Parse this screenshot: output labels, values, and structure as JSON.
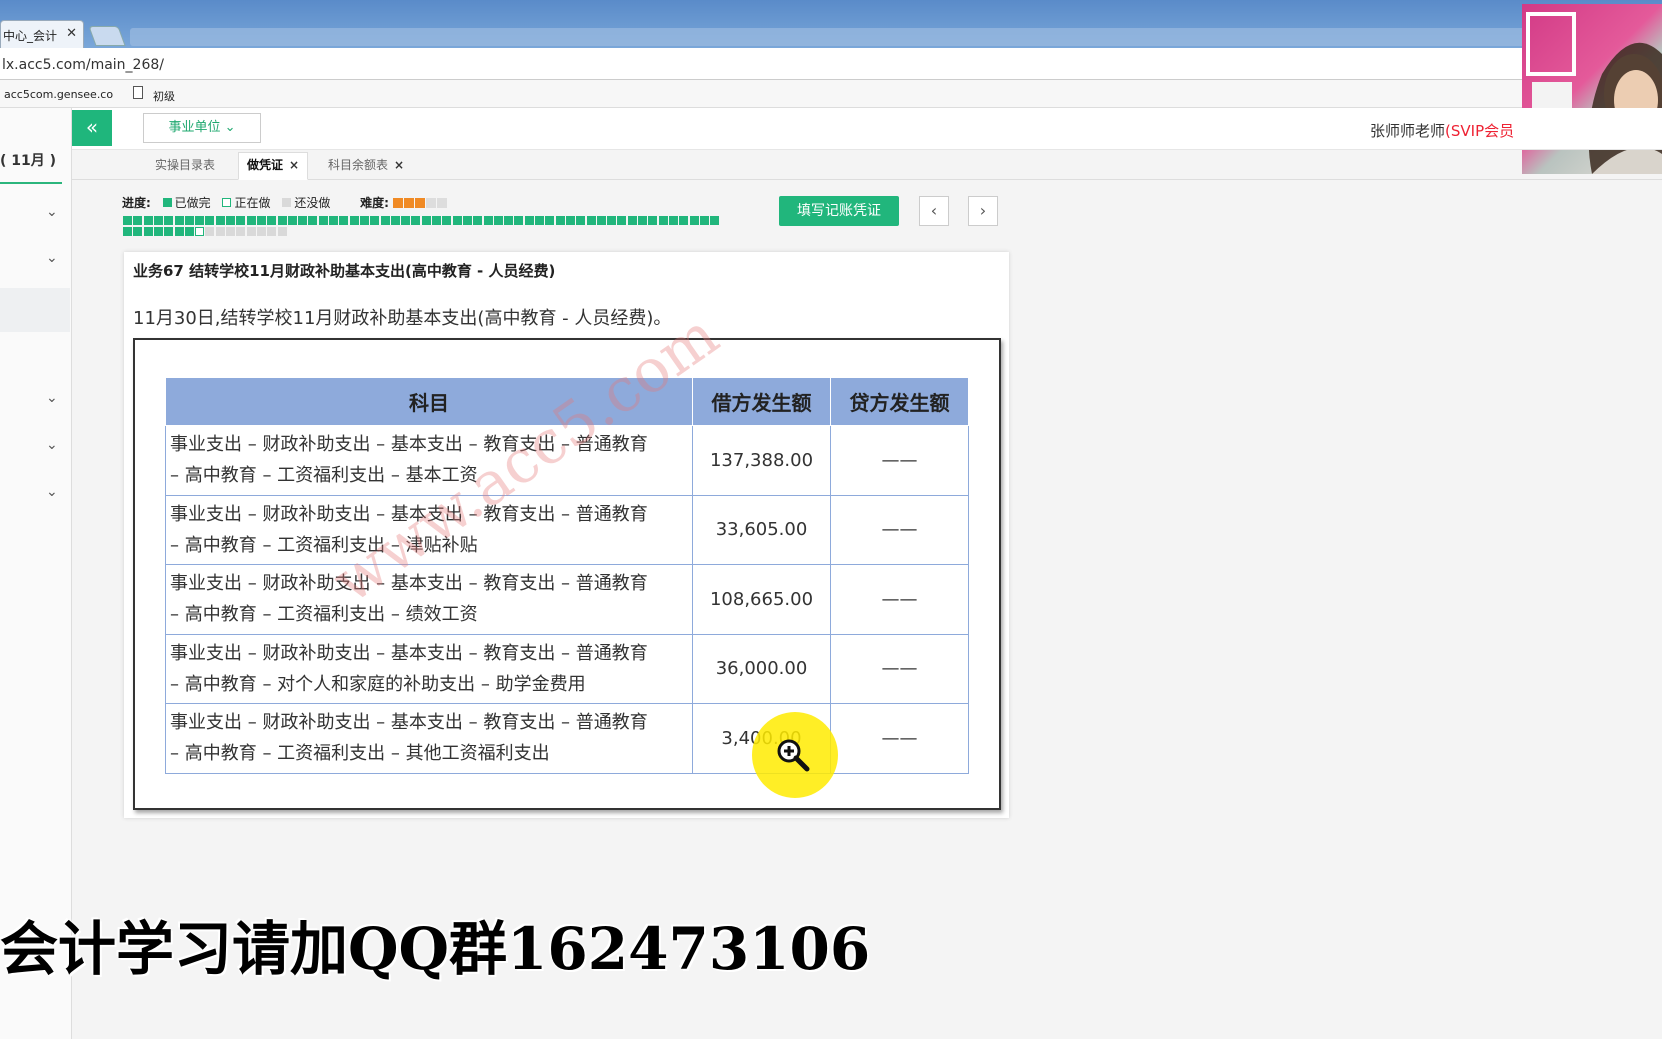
{
  "browser": {
    "tab_title": "中心_会计",
    "address": "lx.acc5.com/main_268/",
    "bookmarks": [
      "acc5com.gensee.co",
      "初级"
    ]
  },
  "sidebar": {
    "period": "( 11月 )"
  },
  "appbar": {
    "unit_select": "事业单位",
    "teacher_name": "张师师老师",
    "teacher_badge": "(SVIP会员"
  },
  "tabs": [
    {
      "label": "实操目录表",
      "active": false,
      "closable": false
    },
    {
      "label": "做凭证",
      "active": true,
      "closable": true
    },
    {
      "label": "科目余额表",
      "active": false,
      "closable": true
    }
  ],
  "progress": {
    "label": "进度:",
    "legend_done": "已做完",
    "legend_doing": "正在做",
    "legend_todo": "还没做",
    "difficulty_label": "难度:",
    "difficulty_stars": 3,
    "difficulty_max": 5,
    "colors": {
      "done": "#21b67c",
      "doing": "#ffffff",
      "todo": "#d9d9d9",
      "star_on": "#f08a24",
      "star_off": "#dddddd"
    },
    "done_count": 65,
    "doing_index": 66,
    "total_cells": 74
  },
  "actions": {
    "fill_voucher": "填写记账凭证",
    "prev_symbol": "‹",
    "next_symbol": "›"
  },
  "question": {
    "title": "业务67 结转学校11月财政补助基本支出(高中教育 - 人员经费)",
    "description": "11月30日,结转学校11月财政补助基本支出(高中教育 - 人员经费)。"
  },
  "entries": {
    "headers": [
      "科目",
      "借方发生额",
      "贷方发生额"
    ],
    "rows": [
      {
        "subject_line1": "事业支出 – 财政补助支出 – 基本支出 – 教育支出 – 普通教育",
        "subject_line2": "– 高中教育 – 工资福利支出 – 基本工资",
        "debit": "137,388.00",
        "credit": "——"
      },
      {
        "subject_line1": "事业支出 – 财政补助支出 – 基本支出 – 教育支出 – 普通教育",
        "subject_line2": "– 高中教育 – 工资福利支出 – 津贴补贴",
        "debit": "33,605.00",
        "credit": "——"
      },
      {
        "subject_line1": "事业支出 – 财政补助支出 – 基本支出 – 教育支出 – 普通教育",
        "subject_line2": "– 高中教育 – 工资福利支出 – 绩效工资",
        "debit": "108,665.00",
        "credit": "——"
      },
      {
        "subject_line1": "事业支出 – 财政补助支出 – 基本支出 – 教育支出 – 普通教育",
        "subject_line2": "– 高中教育 – 对个人和家庭的补助支出 – 助学金费用",
        "debit": "36,000.00",
        "credit": "——"
      },
      {
        "subject_line1": "事业支出 – 财政补助支出 – 基本支出 – 教育支出 – 普通教育",
        "subject_line2": "– 高中教育 – 工资福利支出 – 其他工资福利支出",
        "debit": "3,400.00",
        "credit": "——"
      }
    ]
  },
  "watermark": "www.acc5.com",
  "overlay_banner": "会计学习请加QQ群162473106"
}
